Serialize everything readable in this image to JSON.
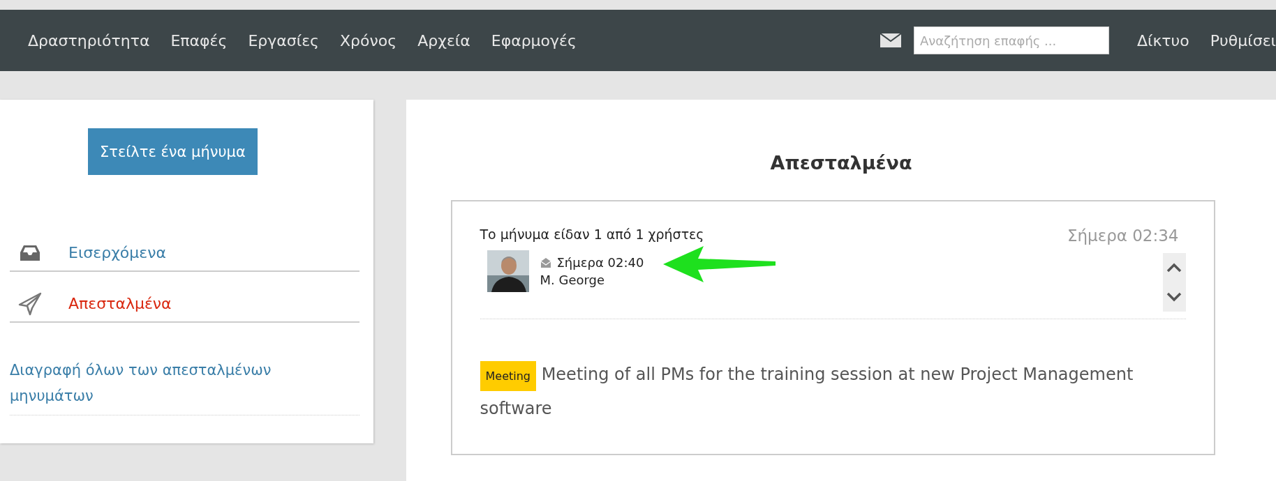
{
  "nav": {
    "items": [
      {
        "label": "Δραστηριότητα"
      },
      {
        "label": "Επαφές"
      },
      {
        "label": "Εργασίες"
      },
      {
        "label": "Χρόνος"
      },
      {
        "label": "Αρχεία"
      },
      {
        "label": "Εφαρμογές"
      }
    ],
    "search": {
      "placeholder": "Αναζήτηση επαφής ..."
    },
    "right_items": [
      {
        "label": "Δίκτυο"
      },
      {
        "label": "Ρυθμίσει"
      }
    ]
  },
  "sidebar": {
    "compose_button": "Στείλτε ένα μήνυμα",
    "folders": [
      {
        "label": "Εισερχόμενα",
        "kind": "inbox",
        "selected": false
      },
      {
        "label": "Απεσταλμένα",
        "kind": "sent",
        "selected": true
      }
    ],
    "delete_link": "Διαγραφή όλων των απεσταλμένων μηνυμάτων"
  },
  "main": {
    "title": "Απεσταλμένα",
    "message": {
      "read_status": "Το μήνυμα είδαν 1 από 1 χρήστες",
      "date": "Σήμερα 02:34",
      "recipients": [
        {
          "time": "Σήμερα 02:40",
          "name": "M. George"
        }
      ],
      "tag": "Meeting",
      "body": "Meeting of all PMs for the training session at new Project Management software"
    }
  }
}
